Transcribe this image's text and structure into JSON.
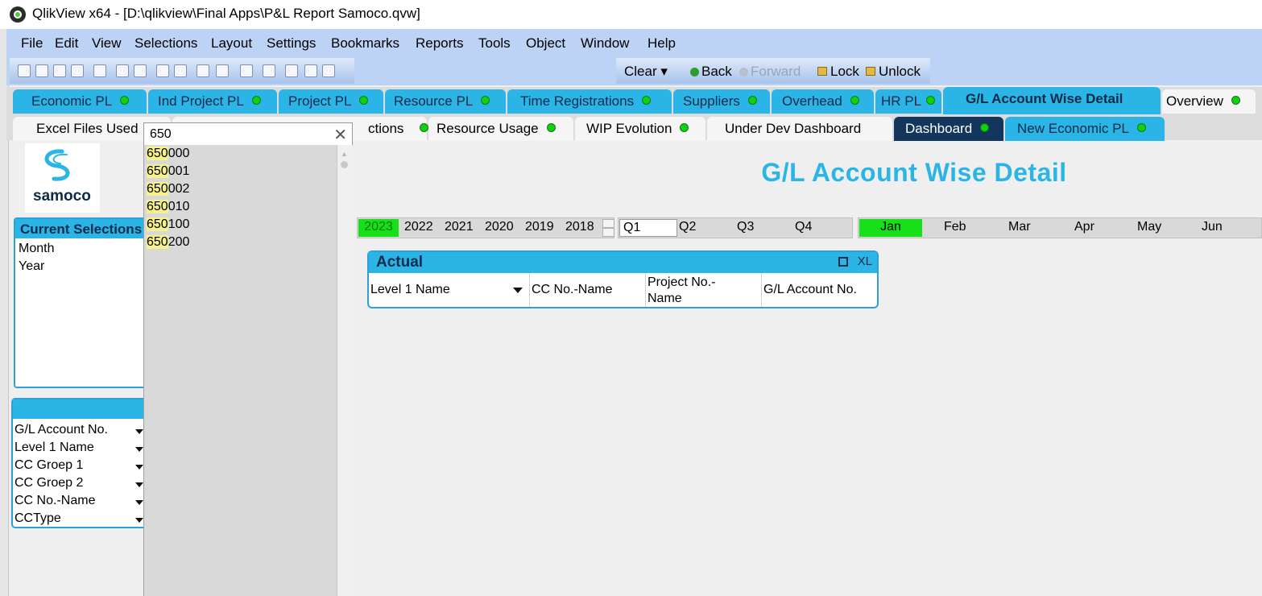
{
  "window": {
    "title": "QlikView x64 - [D:\\qlikview\\Final Apps\\P&L Report Samoco.qvw]"
  },
  "menu": [
    "File",
    "Edit",
    "View",
    "Selections",
    "Layout",
    "Settings",
    "Bookmarks",
    "Reports",
    "Tools",
    "Object",
    "Window",
    "Help"
  ],
  "toolbar": {
    "clear": "Clear",
    "back": "Back",
    "forward": "Forward",
    "lock": "Lock",
    "unlock": "Unlock"
  },
  "tabs_row1": [
    {
      "label": "Economic PL"
    },
    {
      "label": "Ind Project PL"
    },
    {
      "label": "Project PL"
    },
    {
      "label": "Resource PL"
    },
    {
      "label": "Time Registrations"
    },
    {
      "label": "Suppliers"
    },
    {
      "label": "Overhead"
    },
    {
      "label": "HR PL"
    },
    {
      "label": "G/L Account Wise Detail"
    },
    {
      "label": "Overview"
    }
  ],
  "tabs_row2": [
    {
      "label": "Excel Files Used"
    },
    {
      "label": "ctions"
    },
    {
      "label": "Resource Usage"
    },
    {
      "label": "WIP Evolution"
    },
    {
      "label": "Under Dev Dashboard"
    },
    {
      "label": "Dashboard"
    },
    {
      "label": "New Economic PL"
    }
  ],
  "logo": {
    "text": "samoco"
  },
  "current_selections": {
    "title": "Current Selections",
    "rows": [
      "Month",
      "Year"
    ]
  },
  "list_panel": {
    "items": [
      "G/L Account No.",
      "Level 1 Name",
      "CC Groep 1",
      "CC Groep 2",
      "CC No.-Name",
      "CCType"
    ]
  },
  "search": {
    "value": "650",
    "results": [
      {
        "match": "650",
        "rest": "000"
      },
      {
        "match": "650",
        "rest": "001"
      },
      {
        "match": "650",
        "rest": "002"
      },
      {
        "match": "650",
        "rest": "010"
      },
      {
        "match": "650",
        "rest": "100"
      },
      {
        "match": "650",
        "rest": "200"
      }
    ]
  },
  "main": {
    "title": "G/L Account Wise Detail"
  },
  "years": [
    "2023",
    "2022",
    "2021",
    "2020",
    "2019",
    "2018"
  ],
  "selected_year": "2023",
  "quarters": {
    "input_value": "Q1",
    "items": [
      "Q2",
      "Q3",
      "Q4"
    ]
  },
  "months": [
    "Jan",
    "Feb",
    "Mar",
    "Apr",
    "May",
    "Jun"
  ],
  "selected_month": "Jan",
  "actual_table": {
    "title": "Actual",
    "xl": "XL",
    "columns": [
      "Level 1 Name",
      "CC No.-Name",
      "Project No.-\nName",
      "G/L Account No."
    ]
  },
  "colors": {
    "accent": "#2bb5e6",
    "selected": "#18e018",
    "search_highlight": "#f7f189",
    "dashboard_tab": "#12365c"
  }
}
